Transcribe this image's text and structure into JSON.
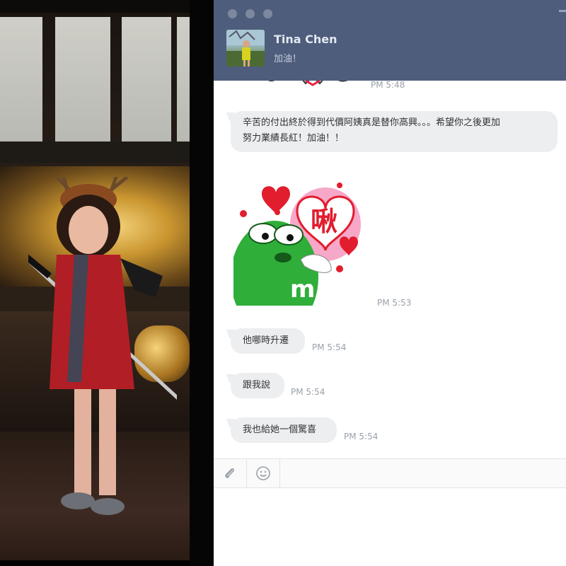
{
  "contact": {
    "name": "Tina Chen",
    "status": "加油！"
  },
  "messages": [
    {
      "type": "sticker",
      "time": "PM 5:48"
    },
    {
      "type": "text",
      "text_line1": "辛苦的付出終於得到代價阿姨真是替你高興。。。希望你之後更加",
      "text_line2": "努力業績長紅！加油！！"
    },
    {
      "type": "sticker",
      "sticker_text": "啾",
      "time": "PM 5:53"
    },
    {
      "type": "text",
      "text": "他哪時升遷",
      "time": "PM 5:54"
    },
    {
      "type": "text",
      "text": "跟我說",
      "time": "PM 5:54"
    },
    {
      "type": "text",
      "text": "我也給她一個驚喜",
      "time": "PM 5:54"
    }
  ],
  "composer": {
    "icons": [
      "paperclip-icon",
      "emoji-icon"
    ]
  },
  "colors": {
    "titlebar": "#4e5d7c",
    "bubble": "#eceef0",
    "timestamp": "#9aa1a9"
  }
}
